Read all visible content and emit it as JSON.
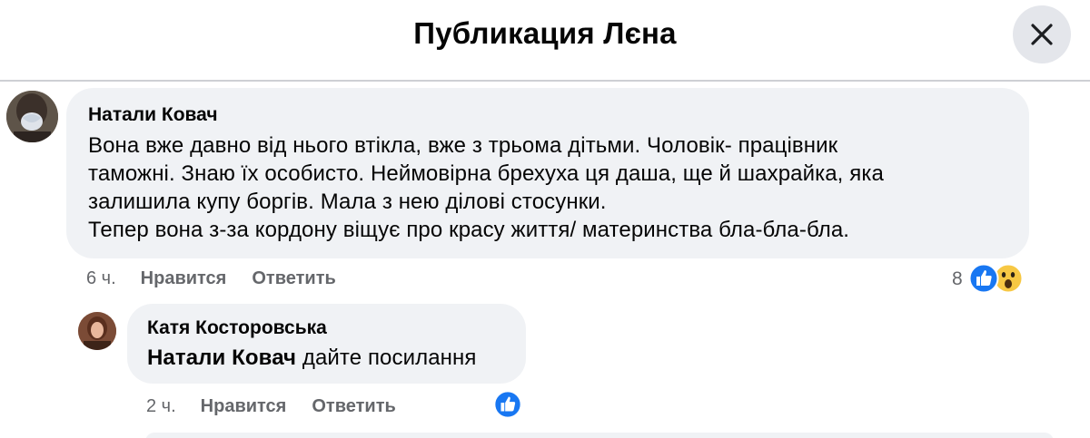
{
  "header": {
    "title": "Публикация Лєна",
    "close_icon": "close-icon"
  },
  "comments": [
    {
      "author": "Натали Ковач",
      "text": "Вона вже давно від нього втікла, вже з трьома дітьми. Чоловік- працівник\nтаможні. Знаю їх особисто. Неймовірна брехуха ця даша, ще й шахрайка, яка\nзалишила купу боргів. Мала з нею ділові стосунки.\nТепер вона з-за кордону віщує про красу життя/ материнства бла-бла-бла.",
      "time": "6 ч.",
      "like_label": "Нравится",
      "reply_label": "Ответить",
      "reaction_count": "8",
      "reactions": [
        "like-icon",
        "wow-icon"
      ]
    },
    {
      "author": "Катя Косторовська",
      "mention": "Натали Ковач",
      "text": " дайте посилання",
      "time": "2 ч.",
      "like_label": "Нравится",
      "reply_label": "Ответить",
      "reactions": [
        "like-icon"
      ]
    }
  ],
  "colors": {
    "bubble": "#f0f2f5",
    "meta_text": "#65676b",
    "like_blue": "#1877f2",
    "wow_yellow": "#f7c844"
  }
}
